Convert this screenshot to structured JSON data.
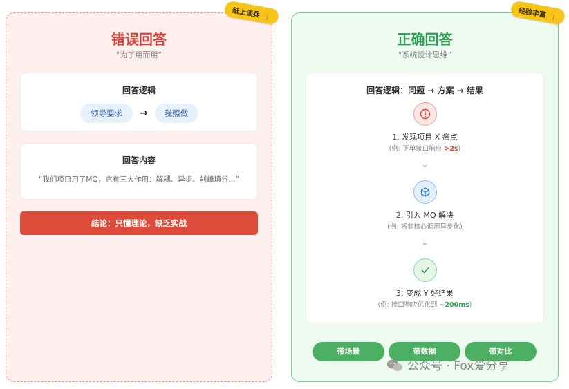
{
  "wrong": {
    "tag": "纸上谈兵 👍",
    "title": "错误回答",
    "subtitle": "“为了用而用”",
    "logic_card": {
      "title": "回答逻辑",
      "from": "领导要求",
      "arrow": "→",
      "to": "我照做"
    },
    "content_card": {
      "title": "回答内容",
      "quote": "“我们项目用了MQ，它有三大作用：解耦、异步、削峰填谷...”"
    },
    "conclusion": "结论：只懂理论，缺乏实战"
  },
  "right": {
    "tag": "经验丰富 👍",
    "title": "正确回答",
    "subtitle": "“系统设计思维”",
    "logic_title": "回答逻辑：问题 → 方案 → 结果",
    "steps": [
      {
        "label": "1. 发现项目 X 痛点",
        "note_prefix": "(例: 下单接口响应 ",
        "note_highlight": ">2s",
        "note_suffix": ")",
        "icon": "alert-icon"
      },
      {
        "label": "2. 引入 MQ 解决",
        "note": "(例: 将非核心调用异步化)",
        "icon": "cube-icon"
      },
      {
        "label": "3. 变成 Y 好结果",
        "note_prefix": "(例: 接口响应优化到 ",
        "note_highlight": "~200ms",
        "note_suffix": ")",
        "icon": "check-icon"
      }
    ],
    "step_arrow": "↓",
    "buttons": [
      "带场景",
      "带数据",
      "带对比"
    ]
  },
  "watermark": "公众号 · Fox爱分享",
  "colors": {
    "wrong_accent": "#d9443a",
    "right_accent": "#2e9e56",
    "tag_yellow": "#f7c518",
    "pill_blue": "#e6f1fb"
  }
}
